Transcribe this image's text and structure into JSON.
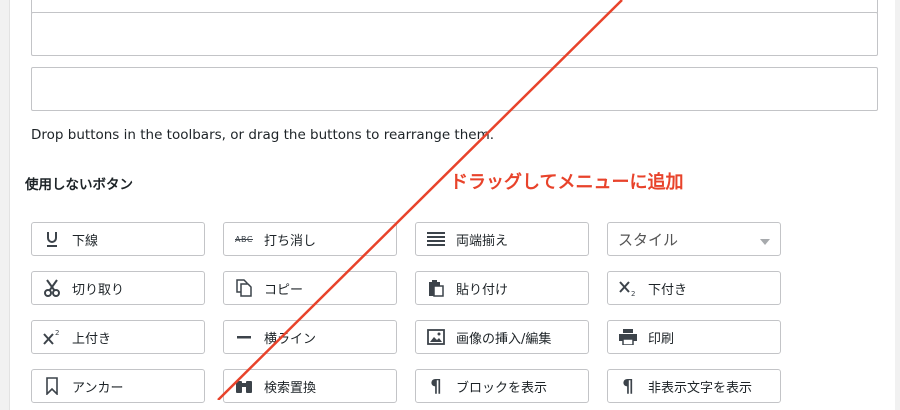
{
  "instructions": "Drop buttons in the toolbars, or drag the buttons to rearrange them.",
  "unused_heading": "使用しないボタン",
  "drag_note": "ドラッグしてメニューに追加",
  "colors": {
    "annotation": "#e8432b",
    "border": "#c3c4c7"
  },
  "buttons": {
    "underline": {
      "label": "下線",
      "icon": "underline-icon"
    },
    "strikethrough": {
      "label": "打ち消し",
      "icon": "strikethrough-icon",
      "icon_text": "ABC"
    },
    "justify": {
      "label": "両端揃え",
      "icon": "justify-icon"
    },
    "style": {
      "label": "スタイル",
      "icon": "chevron-down-icon"
    },
    "cut": {
      "label": "切り取り",
      "icon": "scissors-icon"
    },
    "copy": {
      "label": "コピー",
      "icon": "copy-icon"
    },
    "paste": {
      "label": "貼り付け",
      "icon": "paste-icon"
    },
    "subscript": {
      "label": "下付き",
      "icon": "subscript-icon"
    },
    "superscript": {
      "label": "上付き",
      "icon": "superscript-icon"
    },
    "hr": {
      "label": "横ライン",
      "icon": "horizontal-line-icon"
    },
    "image": {
      "label": "画像の挿入/編集",
      "icon": "image-icon"
    },
    "print": {
      "label": "印刷",
      "icon": "printer-icon"
    },
    "anchor": {
      "label": "アンカー",
      "icon": "bookmark-icon"
    },
    "searchreplace": {
      "label": "検索置換",
      "icon": "binoculars-icon"
    },
    "showblocks": {
      "label": "ブロックを表示",
      "icon": "pilcrow-icon"
    },
    "visualchars": {
      "label": "非表示文字を表示",
      "icon": "pilcrow-icon"
    }
  }
}
